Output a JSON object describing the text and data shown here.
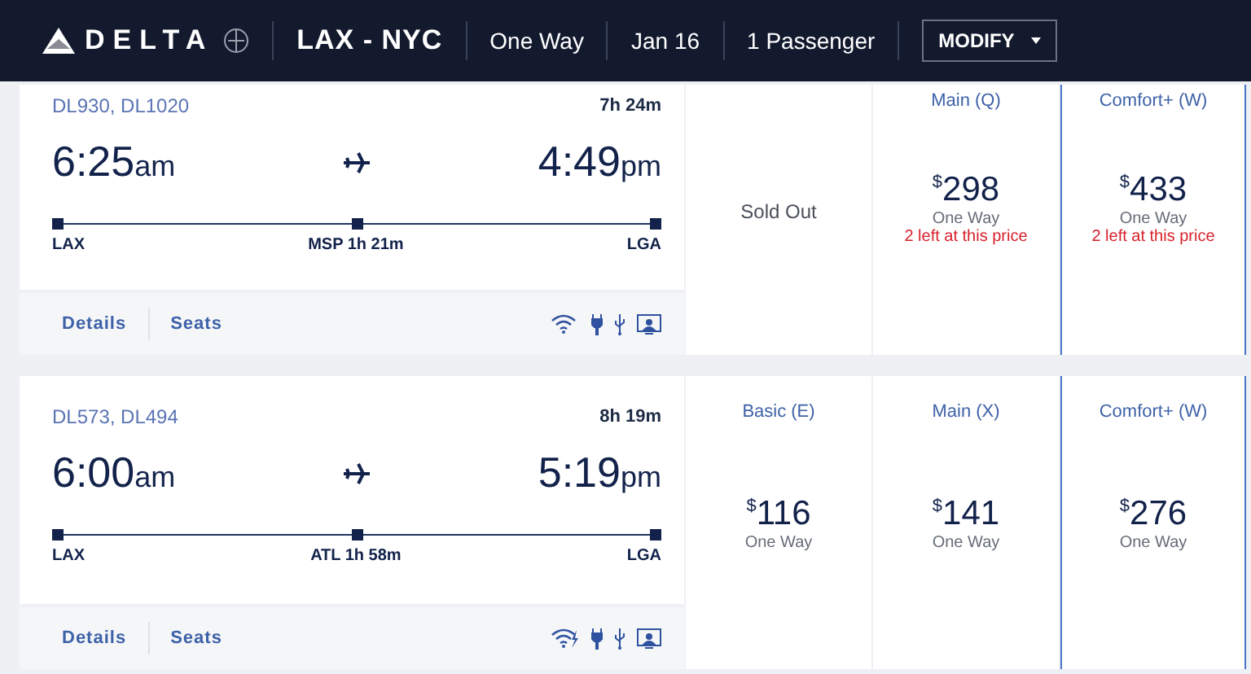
{
  "header": {
    "brand": "DELTA",
    "route": "LAX - NYC",
    "trip_type": "One Way",
    "date": "Jan 16",
    "passengers": "1 Passenger",
    "modify": "MODIFY"
  },
  "flights": [
    {
      "numbers": "DL930, DL1020",
      "duration": "7h 24m",
      "depart": {
        "time": "6:25",
        "ampm": "am"
      },
      "arrive": {
        "time": "4:49",
        "ampm": "pm"
      },
      "origin": "LAX",
      "stop": "MSP 1h 21m",
      "destination": "LGA",
      "links": [
        "Details",
        "Seats"
      ],
      "amenities": [
        {
          "kind": "wifi"
        },
        {
          "kind": "power"
        },
        {
          "kind": "usb"
        },
        {
          "kind": "screen"
        }
      ],
      "top_cut": true,
      "fares": [
        {
          "kind": "sold_out",
          "text": "Sold Out",
          "outlined": false
        },
        {
          "kind": "price",
          "label": "Main (Q)",
          "currency": "$",
          "amount": "298",
          "note": "One Way",
          "remaining": "2 left at this price",
          "outlined": false
        },
        {
          "kind": "price",
          "label": "Comfort+ (W)",
          "currency": "$",
          "amount": "433",
          "note": "One Way",
          "remaining": "2 left at this price",
          "outlined": true
        }
      ]
    },
    {
      "numbers": "DL573, DL494",
      "duration": "8h 19m",
      "depart": {
        "time": "6:00",
        "ampm": "am"
      },
      "arrive": {
        "time": "5:19",
        "ampm": "pm"
      },
      "origin": "LAX",
      "stop": "ATL 1h 58m",
      "destination": "LGA",
      "links": [
        "Details",
        "Seats"
      ],
      "amenities": [
        {
          "kind": "wifi_fast"
        },
        {
          "kind": "power"
        },
        {
          "kind": "usb"
        },
        {
          "kind": "screen"
        }
      ],
      "top_cut": false,
      "fares": [
        {
          "kind": "price",
          "label": "Basic (E)",
          "currency": "$",
          "amount": "116",
          "note": "One Way",
          "outlined": false
        },
        {
          "kind": "price",
          "label": "Main (X)",
          "currency": "$",
          "amount": "141",
          "note": "One Way",
          "outlined": false
        },
        {
          "kind": "price",
          "label": "Comfort+ (W)",
          "currency": "$",
          "amount": "276",
          "note": "One Way",
          "outlined": true
        }
      ]
    }
  ]
}
